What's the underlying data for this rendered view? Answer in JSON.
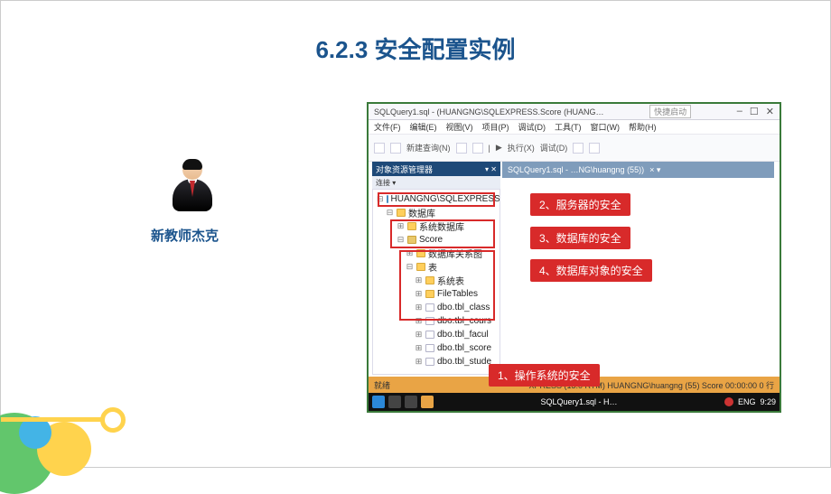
{
  "title": "6.2.3 安全配置实例",
  "avatar_label": "新教师杰克",
  "window": {
    "title": "SQLQuery1.sql - (HUANGNG\\SQLEXPRESS.Score (HUANG…",
    "quicklaunch": "快捷启动",
    "menus": [
      "文件(F)",
      "编辑(E)",
      "视图(V)",
      "项目(P)",
      "调试(D)",
      "工具(T)",
      "窗口(W)",
      "帮助(H)"
    ],
    "toolbar": {
      "new_query": "新建查询(N)",
      "exec": "执行(X)",
      "debug": "调试(D)"
    },
    "panel_title": "对象资源管理器",
    "panel_sub": "连接 ▾",
    "tab": "SQLQuery1.sql - …NG\\huangng (55))",
    "tab_ext": "× ▾",
    "tree": {
      "server": "HUANGNG\\SQLEXPRESS (SQ",
      "db_root": "数据库",
      "sys_db": "系统数据库",
      "user_db": "Score",
      "diagram": "数据库关系图",
      "tables_root": "表",
      "tables": [
        "系统表",
        "FileTables",
        "dbo.tbl_class",
        "dbo.tbl_cours",
        "dbo.tbl_facul",
        "dbo.tbl_score",
        "dbo.tbl_stude"
      ]
    },
    "status": {
      "left": "就绪",
      "right": "XPRESS (13.0 RTM)   HUANGNG\\huangng (55)   Score   00:00:00   0 行"
    },
    "taskbar": {
      "app": "SQLQuery1.sql - H…",
      "lang": "ENG",
      "time": "9:29"
    }
  },
  "callouts": {
    "c1": "1、操作系统的安全",
    "c2": "2、服务器的安全",
    "c3": "3、数据库的安全",
    "c4": "4、数据库对象的安全"
  }
}
